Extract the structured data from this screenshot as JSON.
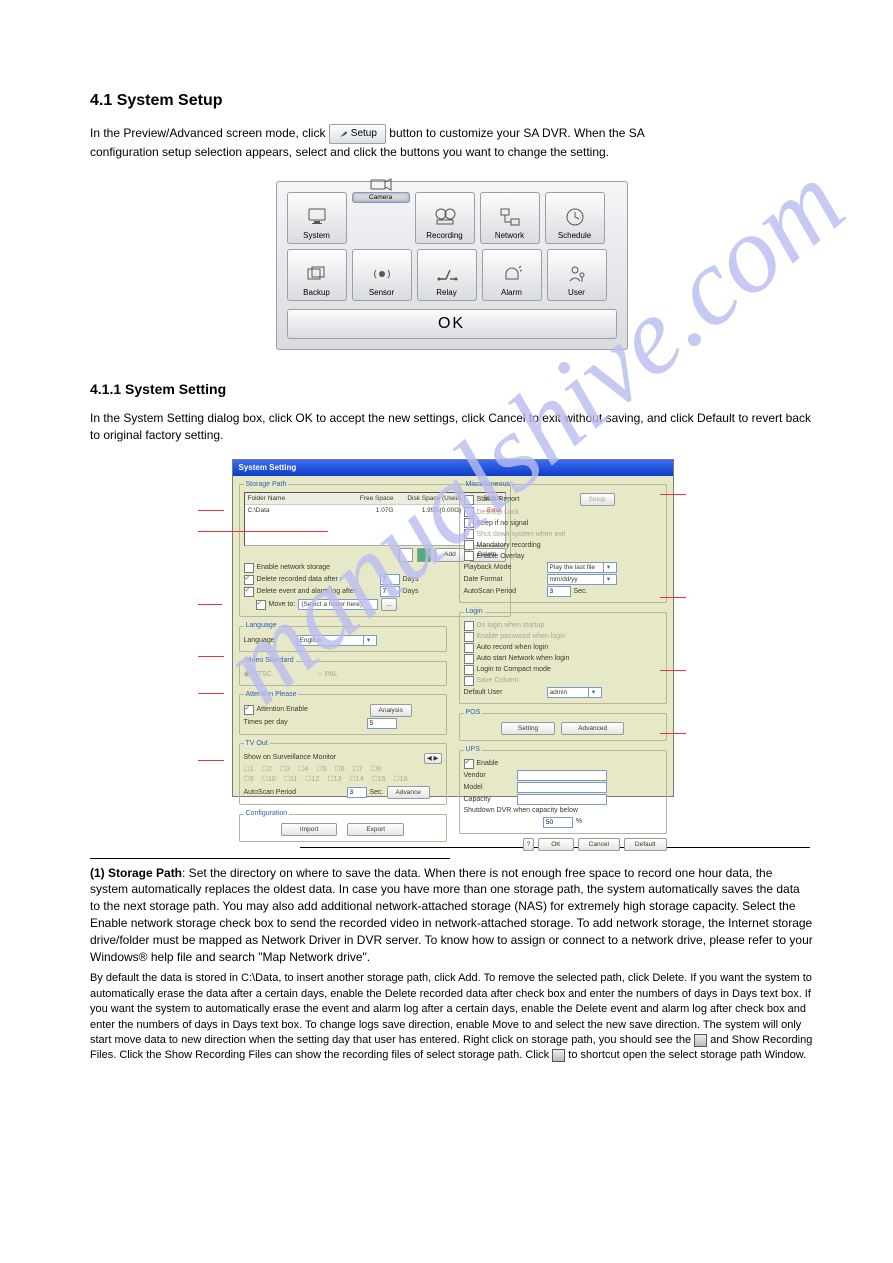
{
  "page": {
    "section_title": "4.1 System Setup",
    "intro_prefix": "In the Preview/Advanced screen mode, click",
    "intro_suffix": "button to customize your SA DVR. When the SA",
    "intro_line2": "configuration setup selection appears, select and click the buttons you want to change the setting.",
    "subsection": "4.1.1 System Setting",
    "subsection_desc": "In the System Setting dialog box, click OK to accept the new settings, click Cancel to exit without saving, and click Default to revert back to original factory setting."
  },
  "setup_btn": {
    "label": "Setup"
  },
  "panel": {
    "tiles": [
      "System",
      "Camera",
      "Recording",
      "Network",
      "Schedule",
      "Backup",
      "Sensor",
      "Relay",
      "Alarm",
      "User"
    ],
    "ok": "OK"
  },
  "ss": {
    "title": "System Setting",
    "storage": {
      "group": "Storage Path",
      "cols": [
        "Folder Name",
        "Free Space",
        "Disk Space (Used)",
        "Status"
      ],
      "row": {
        "folder": "C:\\Data",
        "free": "1.07G",
        "used": "1.95G(0.00G)",
        "status": "Error"
      },
      "add": "Add",
      "delete": "Delete",
      "enable_net": "Enable network storage",
      "del_rec": "Delete recorded data after :",
      "del_evt": "Delete event and alarm log after :",
      "days": "Days",
      "val1": "7",
      "val2": "7",
      "move": "Move to:",
      "move_ph": "(Select a folder here)"
    },
    "lang": {
      "group": "Language",
      "label": "Language",
      "value": "English"
    },
    "vstd": {
      "group": "Video Standard",
      "ntsc": "NTSC",
      "pal": "PAL"
    },
    "att": {
      "group": "Attention Please",
      "enable": "Attention Enable",
      "analysis": "Analysis",
      "tpd": "Times per day",
      "tv": "5"
    },
    "tv": {
      "group": "TV Out",
      "show": "Show on Surveillance Monitor",
      "auto": "AutoScan Period",
      "sec": "Sec.",
      "adv": "Advance"
    },
    "cfg": {
      "group": "Configuration",
      "import": "Import",
      "export": "Export"
    },
    "misc": {
      "group": "Miscellaneous",
      "status": "Status Report",
      "setup": "Setup",
      "lock": "Desktop Lock",
      "beep": "Beep if no signal",
      "shut": "Shut down system when exit",
      "mand": "Mandatory recording",
      "ovl": "Enable Overlay",
      "pbmode": "Playback Mode",
      "pbv": "Play the last file",
      "df": "Date Format",
      "dfv": "mm/dd/yy",
      "ap": "AutoScan Period",
      "apv": "3",
      "sec": "Sec."
    },
    "login": {
      "group": "Login",
      "dlg": "Do login when startup",
      "en": "Enable password when login",
      "ar": "Auto record when login",
      "an": "Auto start Network when login",
      "cm": "Login to Compact mode",
      "sc": "Save Column",
      "du": "Default User",
      "duv": "admin"
    },
    "pos": {
      "group": "POS",
      "setting": "Setting",
      "adv": "Advanced"
    },
    "ups": {
      "group": "UPS",
      "enable": "Enable",
      "vendor": "Vendor",
      "model": "Model",
      "cap": "Capacity",
      "shut": "Shutdown DVR when capacity below",
      "pct": "50",
      "pctu": "%"
    },
    "bottom": {
      "ok": "OK",
      "cancel": "Cancel",
      "default": "Default"
    }
  },
  "desc": {
    "n1_label": "(1) Storage Path",
    "n1_body": ": Set the directory on where to save the data. When there is not enough free space to record one hour data, the system automatically replaces the oldest data. In case you have more than one storage path, the system automatically saves the data to the next storage path. You may also add additional network-attached storage (NAS) for extremely high storage capacity. Select the Enable network storage check box to send the recorded video in network-attached storage. To add network storage, the Internet storage drive/folder must be mapped as Network Driver in DVR server. To know how to assign or connect to a network drive, please refer to your Windows® help file and search \"Map Network drive\".",
    "n1_foot_prefix": "By default the data is stored in C:\\Data, to insert another storage path, click Add. To remove the selected path, click Delete. If you want the system to automatically erase the data after a certain days, enable the Delete recorded data after check box and enter the numbers of days in Days text box. If you want the system to automatically erase the event and alarm log after a certain days, enable the Delete event and alarm log after check box and enter the numbers of days in Days text box. To change logs save direction, enable Move to and select the new save direction. The system will only start move data to new direction when the setting day that user has entered. Right click on storage path, you should see the",
    "n1_foot_mid": " and Show Recording Files. Click the Show Recording Files can show the recording files of select storage path. Click ",
    "n1_foot_end": " to shortcut open the select storage path Window."
  }
}
